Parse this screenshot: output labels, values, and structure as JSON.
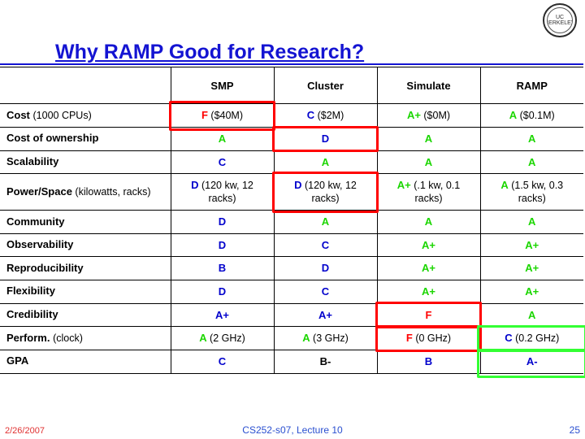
{
  "slide": {
    "title": "Why RAMP Good for Research?",
    "logo_text": "UC BERKELEY"
  },
  "table": {
    "columns": [
      "",
      "SMP",
      "Cluster",
      "Simulate",
      "RAMP"
    ],
    "rows": [
      {
        "label": "Cost ",
        "label_sub": "(1000 CPUs)",
        "cells": [
          {
            "grade": "F",
            "color": "red",
            "note": " ($40M)"
          },
          {
            "grade": "C",
            "color": "blue",
            "note": " ($2M)"
          },
          {
            "grade": "A+",
            "color": "green",
            "note": " ($0M)"
          },
          {
            "grade": "A",
            "color": "green",
            "note": " ($0.1M)"
          }
        ]
      },
      {
        "label": "Cost of ownership",
        "label_sub": "",
        "cells": [
          {
            "grade": "A",
            "color": "green",
            "note": ""
          },
          {
            "grade": "D",
            "color": "blue",
            "note": ""
          },
          {
            "grade": "A",
            "color": "green",
            "note": ""
          },
          {
            "grade": "A",
            "color": "green",
            "note": ""
          }
        ]
      },
      {
        "label": "Scalability",
        "label_sub": "",
        "cells": [
          {
            "grade": "C",
            "color": "blue",
            "note": ""
          },
          {
            "grade": "A",
            "color": "green",
            "note": ""
          },
          {
            "grade": "A",
            "color": "green",
            "note": ""
          },
          {
            "grade": "A",
            "color": "green",
            "note": ""
          }
        ]
      },
      {
        "label": "Power/Space",
        "label_sub": "(kilowatts, racks)",
        "cells": [
          {
            "grade": "D",
            "color": "blue",
            "note": " (120 kw, 12 racks)"
          },
          {
            "grade": "D",
            "color": "blue",
            "note": " (120 kw, 12 racks)"
          },
          {
            "grade": "A+",
            "color": "green",
            "note": " (.1 kw, 0.1 racks)"
          },
          {
            "grade": "A",
            "color": "green",
            "note": " (1.5 kw, 0.3 racks)"
          }
        ]
      },
      {
        "label": "Community",
        "label_sub": "",
        "cells": [
          {
            "grade": "D",
            "color": "blue",
            "note": ""
          },
          {
            "grade": "A",
            "color": "green",
            "note": ""
          },
          {
            "grade": "A",
            "color": "green",
            "note": ""
          },
          {
            "grade": "A",
            "color": "green",
            "note": ""
          }
        ]
      },
      {
        "label": "Observability",
        "label_sub": "",
        "cells": [
          {
            "grade": "D",
            "color": "blue",
            "note": ""
          },
          {
            "grade": "C",
            "color": "blue",
            "note": ""
          },
          {
            "grade": "A+",
            "color": "green",
            "note": ""
          },
          {
            "grade": "A+",
            "color": "green",
            "note": ""
          }
        ]
      },
      {
        "label": "Reproducibility",
        "label_sub": "",
        "cells": [
          {
            "grade": "B",
            "color": "blue",
            "note": ""
          },
          {
            "grade": "D",
            "color": "blue",
            "note": ""
          },
          {
            "grade": "A+",
            "color": "green",
            "note": ""
          },
          {
            "grade": "A+",
            "color": "green",
            "note": ""
          }
        ]
      },
      {
        "label": "Flexibility",
        "label_sub": "",
        "cells": [
          {
            "grade": "D",
            "color": "blue",
            "note": ""
          },
          {
            "grade": "C",
            "color": "blue",
            "note": ""
          },
          {
            "grade": "A+",
            "color": "green",
            "note": ""
          },
          {
            "grade": "A+",
            "color": "green",
            "note": ""
          }
        ]
      },
      {
        "label": "Credibility",
        "label_sub": "",
        "cells": [
          {
            "grade": "A+",
            "color": "blue",
            "note": ""
          },
          {
            "grade": "A+",
            "color": "blue",
            "note": ""
          },
          {
            "grade": "F",
            "color": "red",
            "note": ""
          },
          {
            "grade": "A",
            "color": "green",
            "note": ""
          }
        ]
      },
      {
        "label": "Perform. ",
        "label_sub": "(clock)",
        "cells": [
          {
            "grade": "A",
            "color": "green",
            "note": " (2 GHz)"
          },
          {
            "grade": "A",
            "color": "green",
            "note": " (3 GHz)"
          },
          {
            "grade": "F",
            "color": "red",
            "note": " (0 GHz)"
          },
          {
            "grade": "C",
            "color": "blue",
            "note": " (0.2 GHz)"
          }
        ]
      },
      {
        "label": "GPA",
        "label_sub": "",
        "cells": [
          {
            "grade": "C",
            "color": "blue",
            "note": ""
          },
          {
            "grade": "B-",
            "color": "black",
            "note": ""
          },
          {
            "grade": "B",
            "color": "blue",
            "note": ""
          },
          {
            "grade": "A-",
            "color": "blue",
            "note": ""
          }
        ]
      }
    ]
  },
  "annotations": {
    "boxes": [
      {
        "name": "highlight-cost-smp",
        "color": "red"
      },
      {
        "name": "highlight-ownership-cluster",
        "color": "red"
      },
      {
        "name": "highlight-power-cluster",
        "color": "red"
      },
      {
        "name": "highlight-credibility-simulate",
        "color": "red"
      },
      {
        "name": "highlight-perform-simulate",
        "color": "red"
      },
      {
        "name": "highlight-perform-ramp",
        "color": "green"
      },
      {
        "name": "highlight-gpa-ramp",
        "color": "green"
      }
    ]
  },
  "footer": {
    "date": "2/26/2007",
    "center": "CS252-s07, Lecture 10",
    "page": "25"
  }
}
